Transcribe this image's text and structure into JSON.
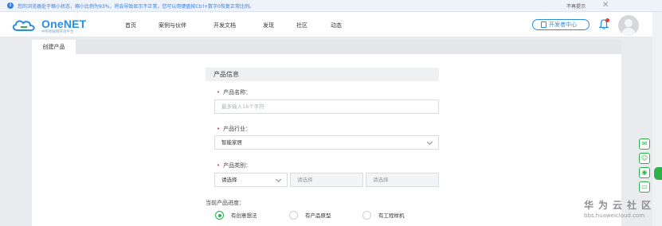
{
  "notice": {
    "text": "您的浏览器处于缩小状态，缩小比例为93%，将会导致显示不正常，您可以用键盘按Ctrl+数字0恢复正常比例。",
    "dismiss_label": "不再提示",
    "close_glyph": "✕"
  },
  "header": {
    "brand": "OneNET",
    "brand_tagline": "中移物联网开放平台",
    "nav": [
      "首页",
      "案例与伙伴",
      "开发文档",
      "发现",
      "社区",
      "动态"
    ],
    "dev_center_label": "开发者中心"
  },
  "tabs": {
    "active_label": "创建产品"
  },
  "form": {
    "section_title": "产品信息",
    "name_label": "产品名称：",
    "name_placeholder": "最多输入16个字符",
    "industry_label": "产品行业：",
    "industry_value": "智能家居",
    "category_label": "产品类别：",
    "category_select1": "请选择",
    "category_select2": "请选择",
    "category_select3": "请选择",
    "progress_label": "当前产品进度：",
    "progress_options": [
      "有创意想法",
      "有产品原型",
      "有工程样机"
    ],
    "progress_selected_index": 0
  },
  "side_tools": {
    "icons": [
      "chat-icon",
      "smile-icon",
      "location-icon",
      "mail-icon"
    ]
  },
  "watermark": {
    "title": "华为云社区",
    "url": "bbs.huaweicloud.com"
  },
  "colors": {
    "accent": "#2a8de4",
    "green": "#2bb24c",
    "required": "#e23b3b"
  }
}
